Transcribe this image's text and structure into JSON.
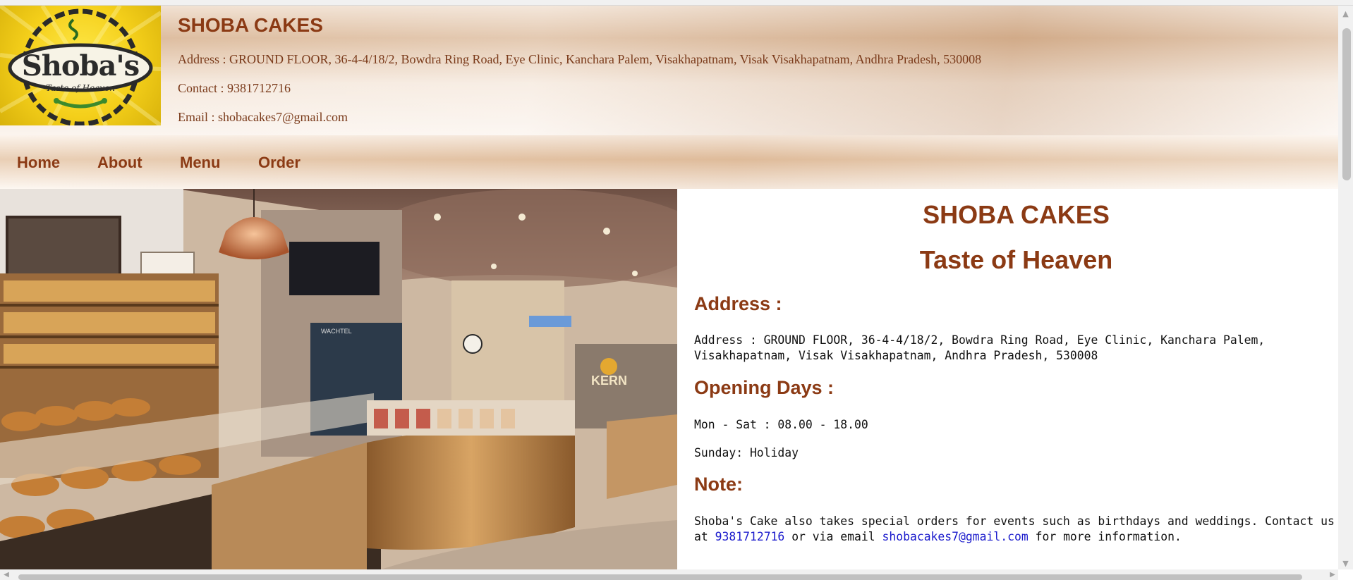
{
  "header": {
    "logo_text": "Shoba's",
    "logo_tagline": "Taste of Heaven",
    "brand": "SHOBA CAKES",
    "address": "Address : GROUND FLOOR, 36-4-4/18/2, Bowdra Ring Road, Eye Clinic, Kanchara Palem, Visakhapatnam, Visak Visakhapatnam, Andhra Pradesh, 530008",
    "contact": "Contact : 9381712716",
    "email": "Email : shobacakes7@gmail.com"
  },
  "nav": {
    "items": [
      {
        "label": "Home"
      },
      {
        "label": "About"
      },
      {
        "label": "Menu"
      },
      {
        "label": "Order"
      }
    ]
  },
  "main": {
    "title": "SHOBA CAKES",
    "subtitle": "Taste of Heaven",
    "address_heading": "Address :",
    "address_line1": "Address : GROUND FLOOR, 36-4-4/18/2, Bowdra Ring Road, Eye Clinic, Kanchara Palem,",
    "address_line2": "Visakhapatnam, Visak Visakhapatnam, Andhra Pradesh, 530008",
    "opening_heading": "Opening Days :",
    "weekdays": "Mon - Sat : 08.00 - 18.00",
    "sunday": "Sunday: Holiday",
    "note_heading": "Note:",
    "note_line1": "Shoba's Cake also takes special orders for events such as birthdays and weddings. Contact us",
    "note_at": "at",
    "note_phone": "9381712716",
    "note_mid": "or via email",
    "note_email": "shobacakes7@gmail.com",
    "note_end": "for more information.",
    "store_sign": "KERN",
    "oven_label": "WACHTEL"
  },
  "colors": {
    "brand": "#8b3a14",
    "link": "#1a1acc",
    "logo_yellow": "#f4cf1a"
  }
}
